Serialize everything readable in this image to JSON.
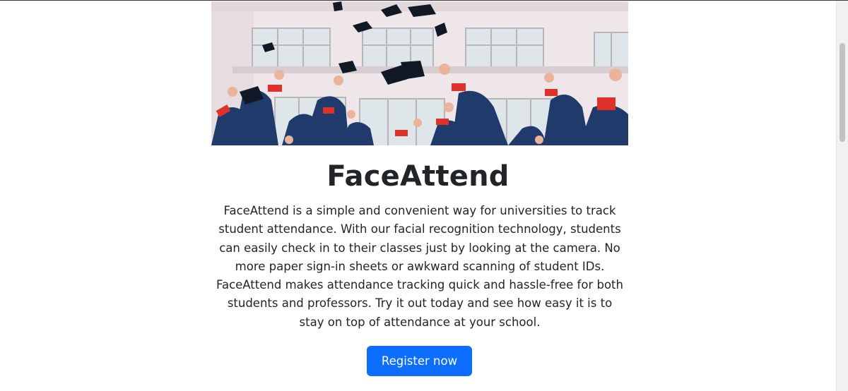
{
  "hero": {
    "image_alt": "Graduates throwing caps in front of a building"
  },
  "main": {
    "title": "FaceAttend",
    "description": "FaceAttend is a simple and convenient way for universities to track student attendance. With our facial recognition technology, students can easily check in to their classes just by looking at the camera. No more paper sign-in sheets or awkward scanning of student IDs. FaceAttend makes attendance tracking quick and hassle-free for both students and professors. Try it out today and see how easy it is to stay on top of attendance at your school.",
    "register_label": "Register now"
  },
  "colors": {
    "primary_button": "#0d6efd",
    "text": "#212529"
  }
}
